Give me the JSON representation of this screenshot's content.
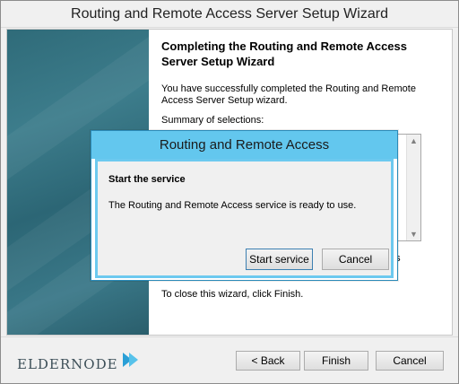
{
  "wizard": {
    "title": "Routing and Remote Access Server Setup Wizard",
    "heading": "Completing the Routing and Remote Access Server Setup Wizard",
    "success_text": "You have successfully completed the Routing and Remote Access Server Setup wizard.",
    "summary_label": "Summary of selections:",
    "tail_text": "es",
    "close_text": "To close this wizard, click Finish.",
    "buttons": {
      "back": "< Back",
      "finish": "Finish",
      "cancel": "Cancel"
    }
  },
  "logo": {
    "text": "eldernode"
  },
  "dialog": {
    "title": "Routing and Remote Access",
    "heading": "Start the service",
    "message": "The Routing and Remote Access service is ready to use.",
    "buttons": {
      "start": "Start service",
      "cancel": "Cancel"
    }
  },
  "colors": {
    "dialog_titlebar": "#63c7ee",
    "sidebar": "#2f6b79"
  },
  "icons": {
    "scroll_up": "▲",
    "scroll_down": "▼"
  }
}
